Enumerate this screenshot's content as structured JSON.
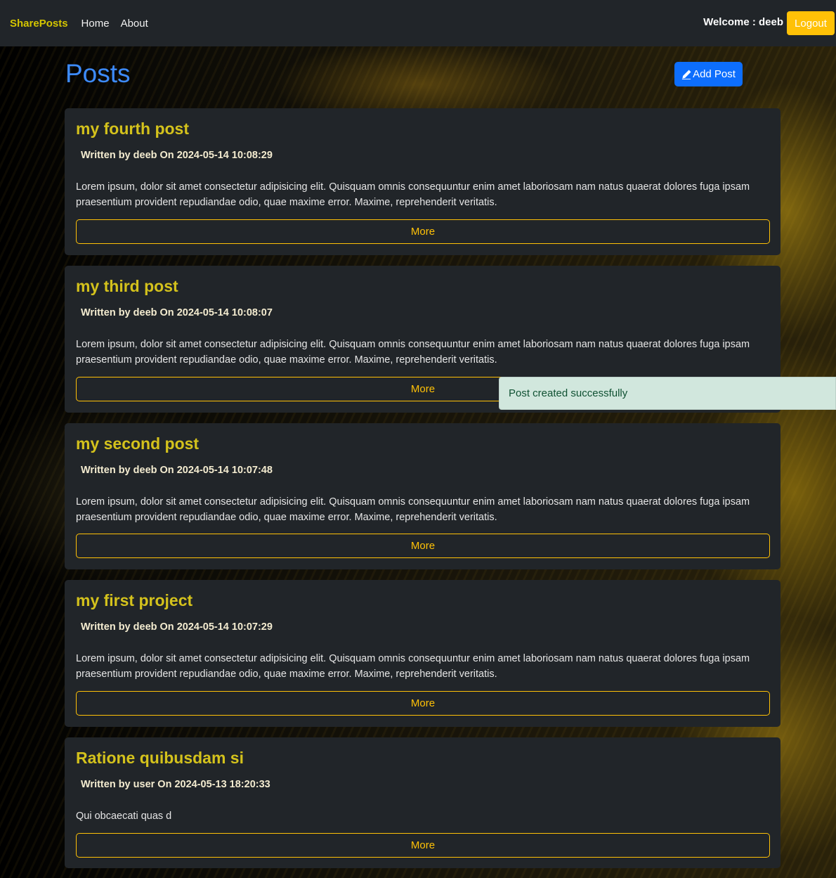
{
  "navbar": {
    "brand": "SharePosts",
    "links": [
      "Home",
      "About"
    ],
    "welcome": "Welcome : deeb",
    "logout_label": "Logout"
  },
  "page": {
    "title": "Posts",
    "add_post_label": "Add Post"
  },
  "posts": [
    {
      "title": "my fourth post",
      "meta": "Written by deeb On 2024-05-14 10:08:29",
      "body": "Lorem ipsum, dolor sit amet consectetur adipisicing elit. Quisquam omnis consequuntur enim amet laboriosam nam natus quaerat dolores fuga ipsam praesentium provident repudiandae odio, quae maxime error. Maxime, reprehenderit veritatis.",
      "more_label": "More"
    },
    {
      "title": "my third post",
      "meta": "Written by deeb On 2024-05-14 10:08:07",
      "body": "Lorem ipsum, dolor sit amet consectetur adipisicing elit. Quisquam omnis consequuntur enim amet laboriosam nam natus quaerat dolores fuga ipsam praesentium provident repudiandae odio, quae maxime error. Maxime, reprehenderit veritatis.",
      "more_label": "More"
    },
    {
      "title": "my second post",
      "meta": "Written by deeb On 2024-05-14 10:07:48",
      "body": "Lorem ipsum, dolor sit amet consectetur adipisicing elit. Quisquam omnis consequuntur enim amet laboriosam nam natus quaerat dolores fuga ipsam praesentium provident repudiandae odio, quae maxime error. Maxime, reprehenderit veritatis.",
      "more_label": "More"
    },
    {
      "title": "my first project",
      "meta": "Written by deeb On 2024-05-14 10:07:29",
      "body": "Lorem ipsum, dolor sit amet consectetur adipisicing elit. Quisquam omnis consequuntur enim amet laboriosam nam natus quaerat dolores fuga ipsam praesentium provident repudiandae odio, quae maxime error. Maxime, reprehenderit veritatis.",
      "more_label": "More"
    },
    {
      "title": "Ratione quibusdam si",
      "meta": "Written by user On 2024-05-13 18:20:33",
      "body": "Qui obcaecati quas d",
      "more_label": "More"
    }
  ],
  "toast": {
    "message": "Post created successfully"
  },
  "colors": {
    "navbar_bg": "#212529",
    "brand": "#d4c500",
    "title_blue": "#3d8bfd",
    "primary": "#0d6efd",
    "warning": "#ffc107",
    "card_bg": "#212529",
    "card_title": "#d4c21c",
    "toast_bg": "#d1e7dd"
  },
  "icons": {
    "add_post": "pencil-icon"
  }
}
